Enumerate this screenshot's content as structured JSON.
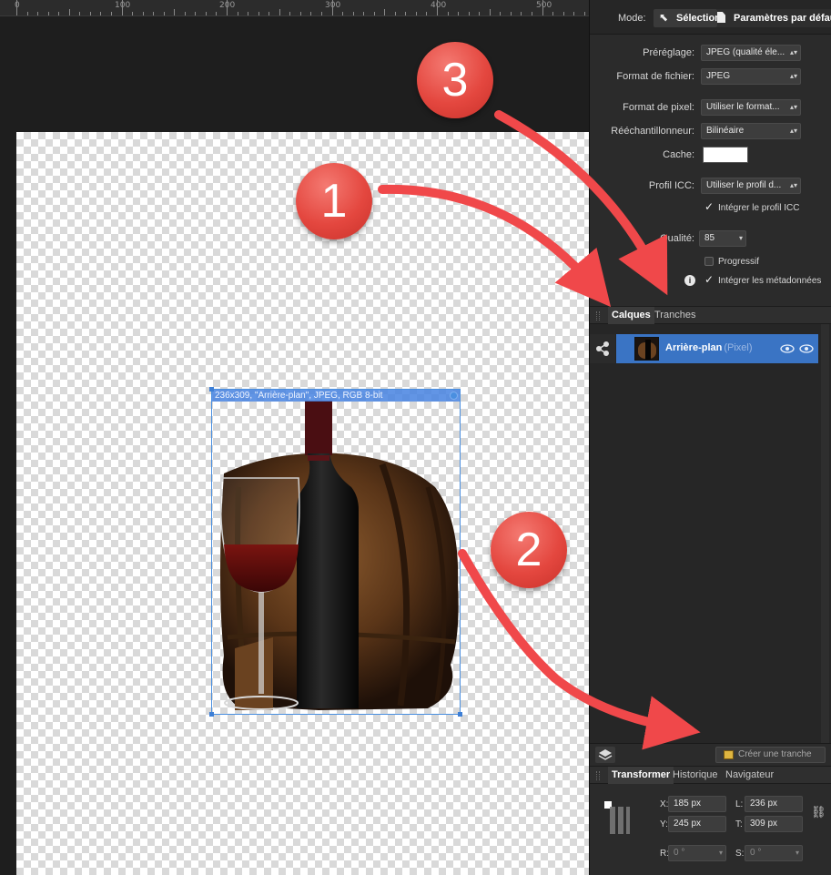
{
  "ruler": {
    "labels": [
      "0",
      "100",
      "200",
      "300",
      "400",
      "500"
    ]
  },
  "canvas": {
    "selection_label": "236x309, \"Arrière-plan\", JPEG, RGB 8-bit"
  },
  "annotations": {
    "badges": [
      "1",
      "2",
      "3"
    ],
    "color": "#e4473f"
  },
  "mode": {
    "label": "Mode:",
    "selection": "Sélection",
    "defaults": "Paramètres par défaut"
  },
  "export": {
    "preset": {
      "label": "Préréglage:",
      "value": "JPEG (qualité éle..."
    },
    "file_format": {
      "label": "Format de fichier:",
      "value": "JPEG"
    },
    "pixel_format": {
      "label": "Format de pixel:",
      "value": "Utiliser le format..."
    },
    "resampler": {
      "label": "Rééchantillonneur:",
      "value": "Bilinéaire"
    },
    "matte": {
      "label": "Cache:",
      "color": "#ffffff"
    },
    "icc_profile": {
      "label": "Profil ICC:",
      "value": "Utiliser le profil d..."
    },
    "embed_icc": {
      "label": "Intégrer le profil ICC",
      "checked": true
    },
    "quality": {
      "label": "Qualité:",
      "value": "85"
    },
    "progressive": {
      "label": "Progressif",
      "checked": false
    },
    "embed_metadata": {
      "label": "Intégrer les métadonnées",
      "checked": true
    }
  },
  "layers_panel": {
    "tabs": [
      "Calques",
      "Tranches"
    ],
    "active_tab": "Calques",
    "layer": {
      "name": "Arrière-plan",
      "type": "(Pixel)"
    }
  },
  "bottom_toolbar": {
    "create_slice": "Créer une tranche"
  },
  "transform_panel": {
    "tabs": [
      "Transformer",
      "Historique",
      "Navigateur"
    ],
    "active_tab": "Transformer",
    "x": {
      "label": "X:",
      "value": "185 px"
    },
    "y": {
      "label": "Y:",
      "value": "245 px"
    },
    "w": {
      "label": "L:",
      "value": "236 px"
    },
    "h": {
      "label": "T:",
      "value": "309 px"
    },
    "r": {
      "label": "R:",
      "value": "0 °"
    },
    "s": {
      "label": "S:",
      "value": "0 °"
    }
  },
  "colors": {
    "accent": "#3a74c4",
    "panel": "#2b2b2b",
    "canvas": "#1e1e1e"
  }
}
